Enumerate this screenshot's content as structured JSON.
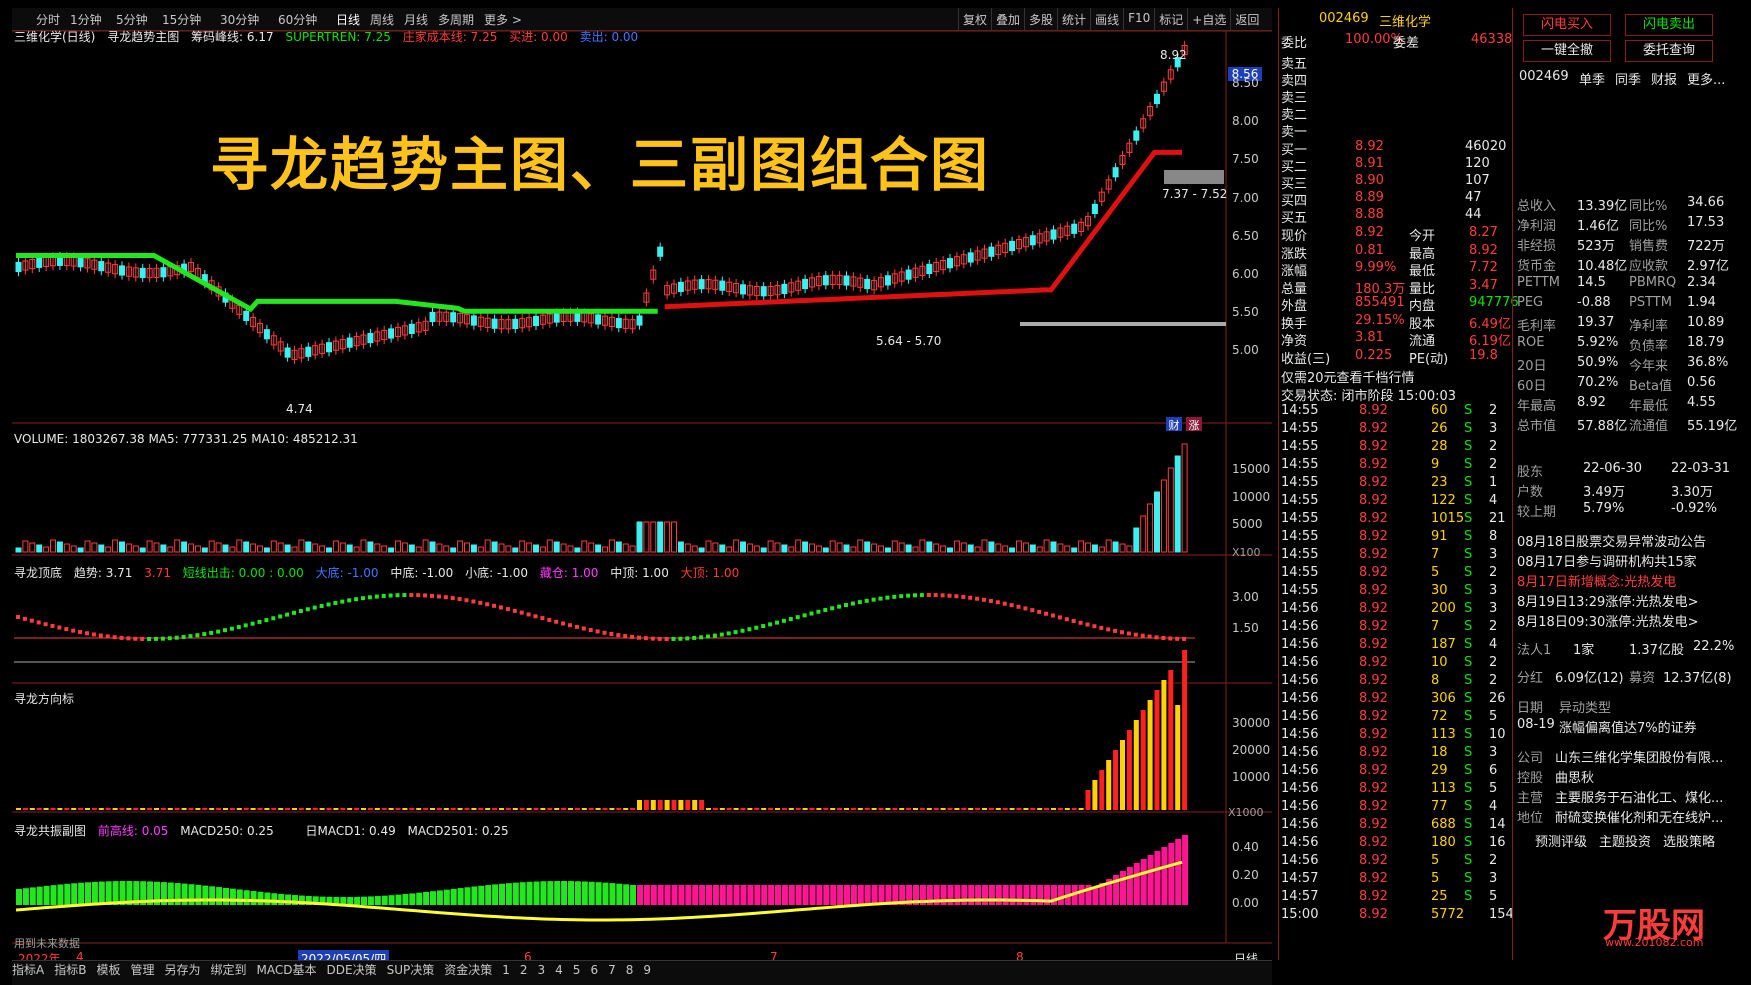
{
  "toolbar": {
    "periods": [
      "分时",
      "1分钟",
      "5分钟",
      "15分钟",
      "30分钟",
      "60分钟",
      "日线",
      "周线",
      "月线",
      "多周期",
      "更多 >"
    ],
    "active_period": "日线",
    "tools": [
      "复权",
      "叠加",
      "多股",
      "统计",
      "画线",
      "F10",
      "标记",
      "+自选",
      "返回"
    ]
  },
  "title_overlay": "寻龙趋势主图、三副图组合图",
  "main_panel": {
    "info": {
      "name": "三维化学(日线)",
      "indicator": "寻龙趋势主图",
      "chip": "筹码峰线: 6.17",
      "supertren": "SUPERTREN: 7.25",
      "cost": "庄家成本线: 7.25",
      "buy": "买进: 0.00",
      "sell": "卖出: 0.00"
    },
    "price_labels": {
      "high": "8.92",
      "low": "4.74",
      "range1": "7.37 - 7.52",
      "range2": "5.64 - 5.70",
      "current": "8.56"
    },
    "y_ticks": [
      "8.50",
      "8.00",
      "7.50",
      "7.00",
      "6.50",
      "6.00",
      "5.50",
      "5.00"
    ],
    "markers": {
      "cai": "财",
      "zhang": "涨"
    }
  },
  "volume_panel": {
    "info": "VOLUME: 1803267.38  MA5: 777331.25  MA10: 485212.31",
    "y_ticks": [
      "15000",
      "10000",
      "5000"
    ],
    "unit": "X100"
  },
  "dingdi_panel": {
    "name": "寻龙顶底",
    "trend": "趋势: 3.71",
    "trend2": "3.71",
    "short_out": "短线出击: 0.00 : 0.00",
    "big_bottom": "大底: -1.00",
    "mid_bottom": "中底: -1.00",
    "small_bottom": "小底: -1.00",
    "hold": "藏仓: 1.00",
    "mid_top": "中顶: 1.00",
    "big_top": "大顶: 1.00",
    "y_ticks": [
      "3.00",
      "1.50"
    ]
  },
  "direction_panel": {
    "name": "寻龙方向标",
    "y_ticks": [
      "30000",
      "20000",
      "10000"
    ],
    "unit": "X1000"
  },
  "resonance_panel": {
    "name": "寻龙共振副图",
    "jin": "前高线: 0.05",
    "macd250": "MACD250: 0.25",
    "daymacd": "日MACD1: 0.49",
    "daymacd2501": "MACD2501: 0.25",
    "y_ticks": [
      "0.40",
      "0.20",
      "0.00"
    ]
  },
  "date_axis": {
    "future_label": "用到未来数据",
    "year": "2022年",
    "months": [
      "4",
      "6",
      "7",
      "8"
    ],
    "cursor_date": "2022/05/05/四",
    "period": "日线"
  },
  "bottom_tabs": [
    "指标A",
    "指标B",
    "模板",
    "管理",
    "另存为",
    "绑定到",
    "MACD基本",
    "DDE决策",
    "SUP决策",
    "资金决策",
    "1",
    "2",
    "3",
    "4",
    "5",
    "6",
    "7",
    "8",
    "9"
  ],
  "quote": {
    "code": "002469",
    "name": "三维化学",
    "weibi_label": "委比",
    "weibi": "100.00%",
    "weicha_label": "委差",
    "weicha": "46338",
    "sells": [
      {
        "label": "卖五"
      },
      {
        "label": "卖四"
      },
      {
        "label": "卖三"
      },
      {
        "label": "卖二"
      },
      {
        "label": "卖一"
      }
    ],
    "buys": [
      {
        "label": "买一",
        "price": "8.92",
        "vol": "46020"
      },
      {
        "label": "买二",
        "price": "8.91",
        "vol": "120"
      },
      {
        "label": "买三",
        "price": "8.90",
        "vol": "107"
      },
      {
        "label": "买四",
        "price": "8.89",
        "vol": "47"
      },
      {
        "label": "买五",
        "price": "8.88",
        "vol": "44"
      }
    ],
    "stats": [
      {
        "l1": "现价",
        "v1": "8.92",
        "l2": "今开",
        "v2": "8.27"
      },
      {
        "l1": "涨跌",
        "v1": "0.81",
        "l2": "最高",
        "v2": "8.92"
      },
      {
        "l1": "涨幅",
        "v1": "9.99%",
        "l2": "最低",
        "v2": "7.72"
      },
      {
        "l1": "总量",
        "v1": "180.3万",
        "l2": "量比",
        "v2": "3.47"
      },
      {
        "l1": "外盘",
        "v1": "855491",
        "l2": "内盘",
        "v2": "947776"
      },
      {
        "l1": "换手",
        "v1": "29.15%",
        "l2": "股本",
        "v2": "6.49亿"
      },
      {
        "l1": "净资",
        "v1": "3.81",
        "l2": "流通",
        "v2": "6.19亿"
      },
      {
        "l1": "收益(三)",
        "v1": "0.225",
        "l2": "PE(动)",
        "v2": "19.8"
      }
    ],
    "promo": "仅需20元查看千档行情",
    "status": "交易状态: 闭市阶段 15:00:03",
    "ticks": [
      [
        "14:55",
        "8.92",
        "60",
        "S",
        "2"
      ],
      [
        "14:55",
        "8.92",
        "26",
        "S",
        "3"
      ],
      [
        "14:55",
        "8.92",
        "28",
        "S",
        "2"
      ],
      [
        "14:55",
        "8.92",
        "9",
        "S",
        "2"
      ],
      [
        "14:55",
        "8.92",
        "23",
        "S",
        "1"
      ],
      [
        "14:55",
        "8.92",
        "122",
        "S",
        "4"
      ],
      [
        "14:55",
        "8.92",
        "1015",
        "S",
        "21"
      ],
      [
        "14:55",
        "8.92",
        "91",
        "S",
        "8"
      ],
      [
        "14:55",
        "8.92",
        "7",
        "S",
        "3"
      ],
      [
        "14:55",
        "8.92",
        "5",
        "S",
        "2"
      ],
      [
        "14:55",
        "8.92",
        "30",
        "S",
        "3"
      ],
      [
        "14:56",
        "8.92",
        "200",
        "S",
        "3"
      ],
      [
        "14:56",
        "8.92",
        "7",
        "S",
        "2"
      ],
      [
        "14:56",
        "8.92",
        "187",
        "S",
        "4"
      ],
      [
        "14:56",
        "8.92",
        "10",
        "S",
        "2"
      ],
      [
        "14:56",
        "8.92",
        "8",
        "S",
        "2"
      ],
      [
        "14:56",
        "8.92",
        "306",
        "S",
        "26"
      ],
      [
        "14:56",
        "8.92",
        "72",
        "S",
        "5"
      ],
      [
        "14:56",
        "8.92",
        "113",
        "S",
        "10"
      ],
      [
        "14:56",
        "8.92",
        "18",
        "S",
        "3"
      ],
      [
        "14:56",
        "8.92",
        "29",
        "S",
        "6"
      ],
      [
        "14:56",
        "8.92",
        "113",
        "S",
        "5"
      ],
      [
        "14:56",
        "8.92",
        "77",
        "S",
        "4"
      ],
      [
        "14:56",
        "8.92",
        "688",
        "S",
        "14"
      ],
      [
        "14:56",
        "8.92",
        "180",
        "S",
        "16"
      ],
      [
        "14:56",
        "8.92",
        "5",
        "S",
        "2"
      ],
      [
        "14:57",
        "8.92",
        "5",
        "S",
        "3"
      ],
      [
        "14:57",
        "8.92",
        "25",
        "S",
        "5"
      ],
      [
        "15:00",
        "8.92",
        "5772",
        "",
        "154"
      ]
    ]
  },
  "f10": {
    "btn_buy": "闪电买入",
    "btn_sell": "闪电卖出",
    "btn_cancel": "一键全撤",
    "btn_query": "委托查询",
    "tabs": [
      "002469",
      "单季",
      "同季",
      "财报",
      "更多..."
    ],
    "fin": [
      [
        "总收入",
        "13.39亿",
        "同比%",
        "34.66"
      ],
      [
        "净利润",
        "1.46亿",
        "同比%",
        "17.53"
      ],
      [
        "非经损",
        "523万",
        "销售费",
        "722万"
      ],
      [
        "货币金",
        "10.48亿",
        "应收款",
        "2.97亿"
      ],
      [
        "PETTM",
        "14.5",
        "PBMRQ",
        "2.34"
      ],
      [
        "PEG",
        "-0.88",
        "PSTTM",
        "1.94"
      ],
      [
        "毛利率",
        "19.37",
        "净利率",
        "10.89"
      ],
      [
        "ROE",
        "5.92%",
        "负债率",
        "18.79"
      ],
      [
        "20日",
        "50.9%",
        "今年来",
        "36.8%"
      ],
      [
        "60日",
        "70.2%",
        "Beta值",
        "0.56"
      ],
      [
        "年最高",
        "8.92",
        "年最低",
        "4.55"
      ],
      [
        "总市值",
        "57.88亿",
        "流通值",
        "55.19亿"
      ]
    ],
    "holders": [
      [
        "股东",
        "22-06-30",
        "22-03-31"
      ],
      [
        "户数",
        "3.49万",
        "3.30万"
      ],
      [
        "较上期",
        "5.79%",
        "-0.92%"
      ]
    ],
    "news": [
      {
        "text": "08月18日股票交易异常波动公告",
        "color": "white"
      },
      {
        "text": "08月17日参与调研机构共15家",
        "color": "white"
      },
      {
        "text": "8月17日新增概念:光热发电",
        "color": "red"
      },
      {
        "text": "8月19日13:29涨停:光热发电>",
        "color": "white"
      },
      {
        "text": "8月18日09:30涨停:光热发电>",
        "color": "white"
      }
    ],
    "legal": [
      "法人1",
      "1家",
      "1.37亿股",
      "22.2%"
    ],
    "dividend": [
      "分红",
      "6.09亿(12)",
      "募资",
      "12.37亿(8)"
    ],
    "event_header": [
      "日期",
      "异动类型"
    ],
    "event": [
      "08-19",
      "涨幅偏离值达7%的证券"
    ],
    "company": [
      [
        "公司",
        "山东三维化学集团股份有限..."
      ],
      [
        "控股",
        "曲思秋"
      ],
      [
        "主营",
        "主要服务于石油化工、煤化..."
      ],
      [
        "地位",
        "耐硫变换催化剂和无在线炉..."
      ]
    ],
    "links": [
      "预测评级",
      "主题投资",
      "选股策略"
    ],
    "watermark": "万股网",
    "watermark_url": "www.201082.com"
  }
}
